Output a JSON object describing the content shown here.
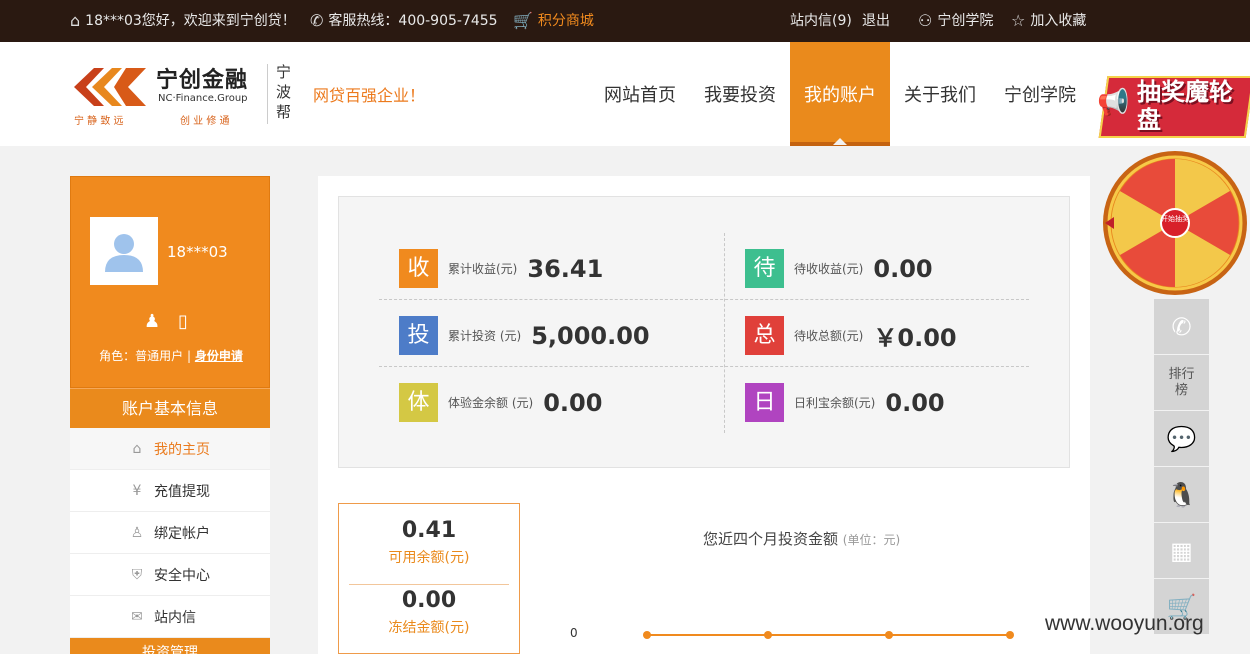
{
  "topbar": {
    "greeting": "18***03您好，欢迎来到宁创贷！",
    "hotline": "客服热线：400-905-7455",
    "points_mall": "积分商城",
    "messages": "站内信(9)",
    "logout": "退出",
    "academy": "宁创学院",
    "favorite": "加入收藏"
  },
  "header": {
    "logo": {
      "cn": "宁创金融",
      "en": "NC·Finance.Group",
      "motto1": "宁 静 致 远",
      "motto2": "创 业 修 通",
      "side": "宁波帮"
    },
    "slogan": "网贷百强企业！",
    "nav": [
      {
        "label": "网站首页"
      },
      {
        "label": "我要投资"
      },
      {
        "label": "我的账户",
        "active": true
      },
      {
        "label": "关于我们"
      },
      {
        "label": "宁创学院"
      }
    ],
    "lottery_banner": "抽奖魔轮盘",
    "wheel_center": "开始抽奖"
  },
  "sidebar": {
    "username": "18***03",
    "role_label": "角色：普通用户 |",
    "id_apply": "身份申请",
    "section_title": "账户基本信息",
    "menu": [
      {
        "label": "我的主页",
        "icon": "home-icon"
      },
      {
        "label": "充值提现",
        "icon": "money-icon"
      },
      {
        "label": "绑定帐户",
        "icon": "user-add-icon"
      },
      {
        "label": "安全中心",
        "icon": "shield-icon"
      },
      {
        "label": "站内信",
        "icon": "mail-icon"
      }
    ],
    "next_section": "投资管理"
  },
  "stats": [
    {
      "badge": "收",
      "label": "累计收益(元)",
      "value": "36.41",
      "color": "#f08a1e"
    },
    {
      "badge": "待",
      "label": "待收收益(元)",
      "value": "0.00",
      "color": "#3dbf8f"
    },
    {
      "badge": "投",
      "label": "累计投资 (元)",
      "value": "5,000.00",
      "color": "#4d7cc8"
    },
    {
      "badge": "总",
      "label": "待收总额(元)",
      "value": "￥0.00",
      "color": "#e0403a"
    },
    {
      "badge": "体",
      "label": "体验金余额 (元)",
      "value": "0.00",
      "color": "#d4c844"
    },
    {
      "badge": "日",
      "label": "日利宝余额(元)",
      "value": "0.00",
      "color": "#b044c0"
    }
  ],
  "balance": {
    "available_value": "0.41",
    "available_label": "可用余额(元)",
    "frozen_value": "0.00",
    "frozen_label": "冻结金额(元)"
  },
  "chart_data": {
    "type": "line",
    "title": "您近四个月投资金额",
    "unit": "(单位：元)",
    "y_tick": "0",
    "values": [
      0,
      0,
      0,
      0
    ],
    "color": "#f08a1e"
  },
  "rightbar": {
    "rank_label1": "排行",
    "rank_label2": "榜"
  },
  "watermark": "www.wooyun.org"
}
